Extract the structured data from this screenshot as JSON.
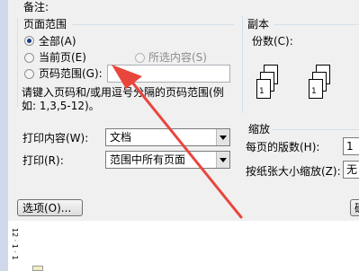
{
  "dialog": {
    "notes_label": "备注:",
    "page_range": {
      "title": "页面范围",
      "all": "全部(A)",
      "current": "当前页(E)",
      "selection": "所选内容(S)",
      "pages": "页码范围(G):",
      "pages_value": "",
      "hint_line1": "请键入页码和/或用逗号分隔的页码范围(例",
      "hint_line2": "如: 1,3,5-12)。"
    },
    "copies": {
      "title": "副本",
      "count_label": "份数(C):",
      "pages_a": [
        "3",
        "2",
        "1"
      ],
      "pages_b": [
        "3",
        "2",
        "1"
      ]
    },
    "print_what_label": "打印内容(W):",
    "print_what_value": "文档",
    "print_label": "打印(R):",
    "print_value": "范围中所有页面",
    "zoom": {
      "title": "缩放",
      "per_sheet_label": "每页的版数(H):",
      "per_sheet_value": "1",
      "scale_label": "按纸张大小缩放(Z):",
      "scale_value": "无"
    },
    "options_button": "选项(O)...",
    "ok_button": "确"
  },
  "ruler": {
    "marks": "12 · 1 · 1"
  },
  "colors": {
    "accent_blue": "#1e1e96",
    "arrow_red": "#e8463c"
  }
}
